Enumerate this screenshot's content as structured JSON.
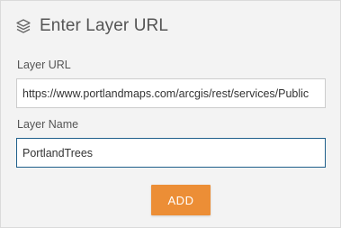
{
  "dialog": {
    "title": "Enter Layer URL",
    "icon": "layers-icon"
  },
  "layer_url": {
    "label": "Layer URL",
    "value": "https://www.portlandmaps.com/arcgis/rest/services/Public"
  },
  "layer_name": {
    "label": "Layer Name",
    "value": "PortlandTrees"
  },
  "add_button": {
    "label": "ADD"
  },
  "colors": {
    "accent_button": "#ec8e36",
    "panel_background": "#f3f3f3",
    "focused_border": "#1f5f8b"
  }
}
